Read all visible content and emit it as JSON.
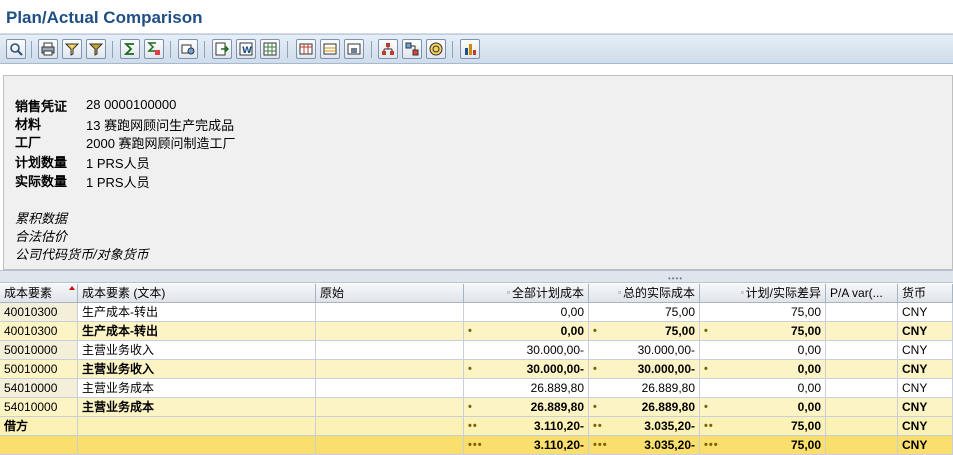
{
  "window": {
    "title": "Plan/Actual Comparison"
  },
  "toolbar": {
    "buttons": [
      {
        "icon": "detail-icon"
      },
      {
        "icon": "print-icon"
      },
      {
        "icon": "filter-icon"
      },
      {
        "icon": "set-filter-icon"
      },
      {
        "icon": "sum-icon"
      },
      {
        "icon": "subtotal-icon"
      },
      {
        "icon": "view-icon"
      },
      {
        "icon": "export-icon"
      },
      {
        "icon": "word-icon"
      },
      {
        "icon": "spreadsheet-icon"
      },
      {
        "icon": "columns-icon"
      },
      {
        "icon": "layout-choose-icon"
      },
      {
        "icon": "layout-save-icon"
      },
      {
        "icon": "hierarchy-icon"
      },
      {
        "icon": "graphic-icon"
      },
      {
        "icon": "info-icon"
      },
      {
        "icon": "chart-icon"
      }
    ]
  },
  "header": {
    "fields": [
      {
        "label": "销售凭证",
        "value": "28 0000100000"
      },
      {
        "label": "材料",
        "value": "13 赛跑网顾问生产完成品"
      },
      {
        "label": "工厂",
        "value": "2000 赛跑网顾问制造工厂"
      },
      {
        "label": "计划数量",
        "value": "1 PRS人员"
      },
      {
        "label": "实际数量",
        "value": "1 PRS人员"
      }
    ],
    "notes": [
      "累积数据",
      "合法估价",
      "公司代码货币/对象货币"
    ]
  },
  "grid": {
    "columns": [
      "成本要素",
      "成本要素 (文本)",
      "原始",
      "全部计划成本",
      "总的实际成本",
      "计划/实际差异",
      "P/A var(...",
      "货币"
    ],
    "rows": [
      {
        "type": "plain",
        "element": "40010300",
        "text": "生产成本-转出",
        "origin": "",
        "plan": "0,00",
        "actual": "75,00",
        "variance": "75,00",
        "pavar": "",
        "currency": "CNY",
        "dots": ""
      },
      {
        "type": "sub",
        "element": "40010300",
        "text": "生产成本-转出",
        "origin": "",
        "plan": "0,00",
        "actual": "75,00",
        "variance": "75,00",
        "pavar": "",
        "currency": "CNY",
        "dots": "•"
      },
      {
        "type": "plain",
        "element": "50010000",
        "text": "主营业务收入",
        "origin": "",
        "plan": "30.000,00-",
        "actual": "30.000,00-",
        "variance": "0,00",
        "pavar": "",
        "currency": "CNY",
        "dots": ""
      },
      {
        "type": "sub",
        "element": "50010000",
        "text": "主营业务收入",
        "origin": "",
        "plan": "30.000,00-",
        "actual": "30.000,00-",
        "variance": "0,00",
        "pavar": "",
        "currency": "CNY",
        "dots": "•"
      },
      {
        "type": "plain",
        "element": "54010000",
        "text": "主营业务成本",
        "origin": "",
        "plan": "26.889,80",
        "actual": "26.889,80",
        "variance": "0,00",
        "pavar": "",
        "currency": "CNY",
        "dots": ""
      },
      {
        "type": "sub",
        "element": "54010000",
        "text": "主营业务成本",
        "origin": "",
        "plan": "26.889,80",
        "actual": "26.889,80",
        "variance": "0,00",
        "pavar": "",
        "currency": "CNY",
        "dots": "•"
      },
      {
        "type": "tot1",
        "element": "借方",
        "text": "",
        "origin": "",
        "plan": "3.110,20-",
        "actual": "3.035,20-",
        "variance": "75,00",
        "pavar": "",
        "currency": "CNY",
        "dots": "••"
      },
      {
        "type": "tot2",
        "element": "",
        "text": "",
        "origin": "",
        "plan": "3.110,20-",
        "actual": "3.035,20-",
        "variance": "75,00",
        "pavar": "",
        "currency": "CNY",
        "dots": "•••"
      }
    ]
  }
}
